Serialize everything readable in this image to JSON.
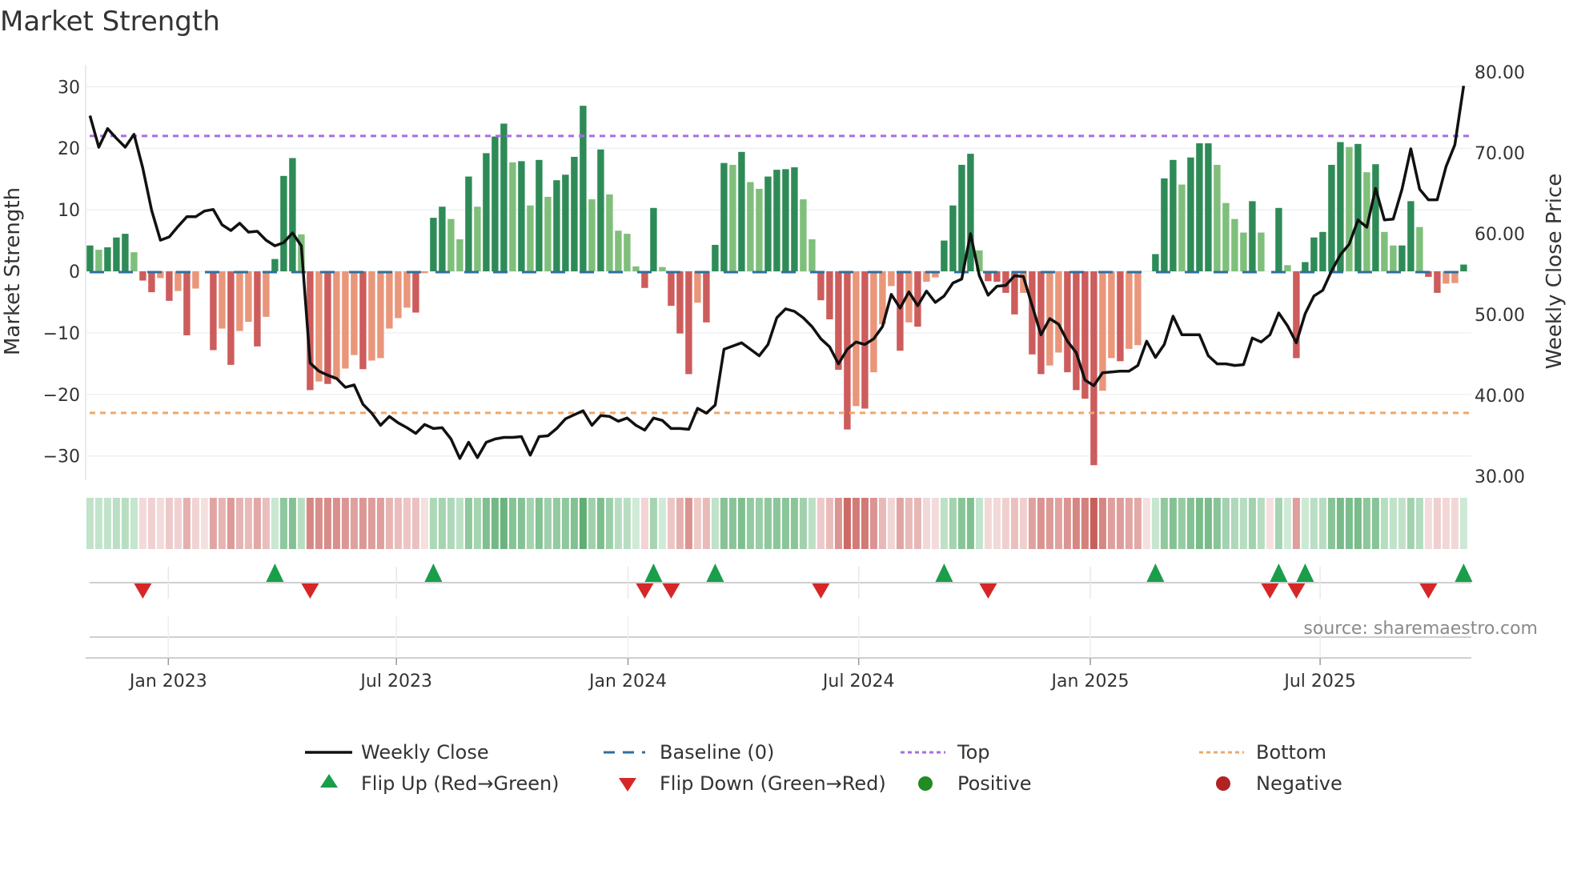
{
  "chart_data": {
    "type": "bar+line",
    "title": "Market Strength",
    "ylabel_left": "Market Strength",
    "ylabel_right": "Weekly Close Price",
    "ylim_left": [
      -35,
      32
    ],
    "ylim_right": [
      30,
      80
    ],
    "yticks_left": [
      30,
      20,
      10,
      0,
      -10,
      -20,
      -30
    ],
    "yticks_left_labels": [
      "30",
      "20",
      "10",
      "0",
      "−10",
      "−20",
      "−30"
    ],
    "yticks_right": [
      80,
      70,
      60,
      50,
      40,
      30
    ],
    "yticks_right_labels": [
      "80.00",
      "70.00",
      "60.00",
      "50.00",
      "40.00",
      "30.00"
    ],
    "xticks": [
      {
        "label": "Jan 2023",
        "week_index": 8.9
      },
      {
        "label": "Jul 2023",
        "week_index": 34.8
      },
      {
        "label": "Jan 2024",
        "week_index": 61.1
      },
      {
        "label": "Jul 2024",
        "week_index": 87.3
      },
      {
        "label": "Jan 2025",
        "week_index": 113.6
      },
      {
        "label": "Jul 2025",
        "week_index": 139.7
      }
    ],
    "top_level": 22,
    "bottom_level": -23,
    "baseline": 0,
    "strength": [
      4.2,
      3.5,
      3.9,
      5.5,
      6.1,
      3.1,
      -1.5,
      -3.4,
      -1.1,
      -4.8,
      -3.2,
      -10.4,
      -2.8,
      0,
      -12.8,
      -9.3,
      -15.2,
      -9.7,
      -8.2,
      -12.2,
      -7.4,
      2.0,
      15.5,
      18.4,
      6.0,
      -19.3,
      -17.9,
      -18.3,
      -17.6,
      -15.8,
      -13.6,
      -15.9,
      -14.5,
      -14.1,
      -9.3,
      -7.6,
      -5.9,
      -6.7,
      -0.3,
      8.7,
      10.5,
      8.5,
      5.2,
      15.4,
      10.5,
      19.2,
      21.9,
      24.0,
      17.7,
      17.9,
      10.7,
      18.1,
      12.1,
      14.8,
      15.7,
      18.6,
      26.9,
      11.7,
      19.8,
      12.5,
      6.6,
      6.1,
      0.8,
      -2.7,
      10.3,
      0.7,
      -5.6,
      -10.1,
      -16.7,
      -5.1,
      -8.3,
      4.3,
      17.6,
      17.3,
      19.4,
      14.5,
      13.4,
      15.4,
      16.5,
      16.6,
      16.9,
      11.7,
      5.2,
      -4.7,
      -7.8,
      -16.0,
      -25.7,
      -21.9,
      -22.3,
      -16.4,
      -8.6,
      -2.4,
      -12.9,
      -8.3,
      -9.0,
      -1.7,
      -1.0,
      5.0,
      10.7,
      17.3,
      19.1,
      3.4,
      -1.6,
      -1.7,
      -3.5,
      -7.0,
      -3.5,
      -13.5,
      -16.7,
      -15.3,
      -13.2,
      -16.4,
      -19.3,
      -20.7,
      -31.5,
      -19.4,
      -14.1,
      -14.6,
      -12.6,
      -12.0,
      0,
      2.8,
      15.1,
      18.1,
      14.1,
      18.5,
      20.8,
      20.8,
      17.3,
      11.1,
      8.5,
      6.3,
      11.4,
      6.3,
      0,
      10.3,
      1.0,
      -14.1,
      1.5,
      5.5,
      6.4,
      17.3,
      21.0,
      20.2,
      20.7,
      16.1,
      17.4,
      6.4,
      4.2,
      4.2,
      11.4,
      7.2,
      -0.9,
      -3.5,
      -2.0,
      -1.9,
      1.1
    ],
    "weekly_close": [
      74.6,
      70.7,
      73.0,
      71.8,
      70.7,
      72.3,
      68.1,
      62.9,
      59.2,
      59.6,
      60.9,
      62.1,
      62.1,
      62.8,
      63.0,
      61.1,
      60.4,
      61.3,
      60.2,
      60.3,
      59.2,
      58.5,
      58.9,
      60.1,
      58.5,
      44.0,
      43.0,
      42.5,
      42.1,
      41.0,
      41.3,
      38.9,
      37.8,
      36.3,
      37.4,
      36.6,
      36.0,
      35.3,
      36.4,
      35.9,
      36.0,
      34.6,
      32.2,
      34.2,
      32.3,
      34.2,
      34.6,
      34.8,
      34.8,
      34.9,
      32.6,
      34.9,
      35.0,
      35.9,
      37.1,
      37.6,
      38.1,
      36.3,
      37.5,
      37.4,
      36.8,
      37.2,
      36.3,
      35.7,
      37.2,
      36.9,
      35.9,
      35.9,
      35.8,
      38.4,
      37.8,
      38.8,
      45.7,
      46.1,
      46.5,
      45.7,
      44.9,
      46.3,
      49.6,
      50.7,
      50.4,
      49.6,
      48.5,
      47.0,
      46.0,
      43.9,
      45.7,
      46.6,
      46.3,
      47.0,
      48.5,
      52.5,
      50.8,
      52.8,
      51.1,
      52.9,
      51.5,
      52.3,
      53.9,
      54.4,
      60.0,
      54.8,
      52.4,
      53.5,
      53.6,
      54.8,
      54.7,
      51.1,
      47.5,
      49.5,
      48.8,
      46.7,
      45.3,
      41.9,
      41.2,
      42.8,
      42.9,
      43.0,
      43.0,
      43.7,
      46.7,
      44.7,
      46.3,
      49.8,
      47.5,
      47.5,
      47.5,
      44.9,
      43.9,
      43.9,
      43.7,
      43.8,
      47.1,
      46.6,
      47.5,
      50.2,
      48.6,
      46.5,
      50.1,
      52.3,
      53.0,
      55.4,
      57.4,
      58.7,
      61.7,
      60.8,
      65.6,
      61.7,
      61.8,
      65.5,
      70.5,
      65.5,
      64.2,
      64.2,
      68.3,
      71.0,
      78.3
    ],
    "legend": {
      "placement": "bottom",
      "weekly_close": "Weekly Close",
      "baseline": "Baseline (0)",
      "top": "Top",
      "bottom": "Bottom",
      "flip_up": "Flip Up (Red→Green)",
      "flip_down": "Flip Down (Green→Red)",
      "positive": "Positive",
      "negative": "Negative"
    },
    "source": "source: sharemaestro.com"
  },
  "colors": {
    "pos_strong": "#2e8b57",
    "pos_weak": "#7fbf7b",
    "neg_strong": "#cd5c5c",
    "neg_weak": "#e9967a",
    "close_line": "#111111",
    "baseline": "#2f6f9f",
    "top": "#a66ee8",
    "bottom": "#f0a868",
    "flip_up": "#1a9e4a",
    "flip_down": "#d62728",
    "positive_dot": "#228b22",
    "negative_dot": "#b22222"
  }
}
